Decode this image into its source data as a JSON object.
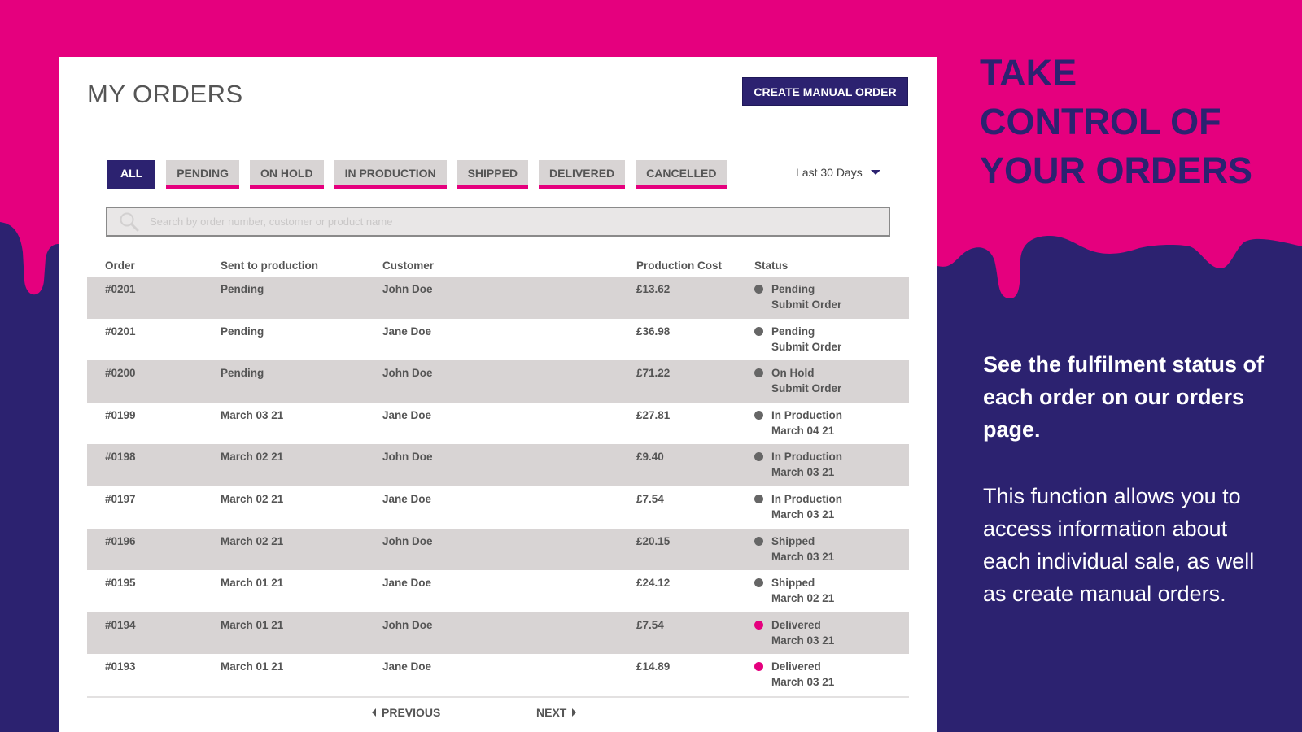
{
  "colors": {
    "brand_pink": "#e5007e",
    "brand_navy": "#2c2270",
    "row_shade": "#d8d4d4",
    "status_grey": "#666666",
    "status_delivered": "#e5007e"
  },
  "header": {
    "title": "MY ORDERS",
    "create_button": "CREATE MANUAL ORDER"
  },
  "filters": {
    "tabs": [
      {
        "label": "ALL",
        "active": true
      },
      {
        "label": "PENDING",
        "active": false
      },
      {
        "label": "ON HOLD",
        "active": false
      },
      {
        "label": "IN PRODUCTION",
        "active": false
      },
      {
        "label": "SHIPPED",
        "active": false
      },
      {
        "label": "DELIVERED",
        "active": false
      },
      {
        "label": "CANCELLED",
        "active": false
      }
    ],
    "date_range": "Last 30 Days"
  },
  "search": {
    "icon": "search-icon",
    "placeholder": "Search by order number, customer or product name",
    "value": ""
  },
  "table": {
    "columns": [
      "Order",
      "Sent to production",
      "Customer",
      "Production Cost",
      "Status"
    ],
    "rows": [
      {
        "order": "#0201",
        "sent": "Pending",
        "customer": "John Doe",
        "cost": "£13.62",
        "status": "Pending",
        "status_sub": "Submit Order",
        "dot": "grey"
      },
      {
        "order": "#0201",
        "sent": "Pending",
        "customer": "Jane Doe",
        "cost": "£36.98",
        "status": "Pending",
        "status_sub": "Submit Order",
        "dot": "grey"
      },
      {
        "order": "#0200",
        "sent": "Pending",
        "customer": "John Doe",
        "cost": "£71.22",
        "status": "On Hold",
        "status_sub": "Submit Order",
        "dot": "grey"
      },
      {
        "order": "#0199",
        "sent": "March 03 21",
        "customer": "Jane Doe",
        "cost": "£27.81",
        "status": "In Production",
        "status_sub": "March 04 21",
        "dot": "grey"
      },
      {
        "order": "#0198",
        "sent": "March 02 21",
        "customer": "John Doe",
        "cost": "£9.40",
        "status": "In Production",
        "status_sub": "March 03 21",
        "dot": "grey"
      },
      {
        "order": "#0197",
        "sent": "March 02 21",
        "customer": "Jane Doe",
        "cost": "£7.54",
        "status": "In Production",
        "status_sub": "March 03 21",
        "dot": "grey"
      },
      {
        "order": "#0196",
        "sent": "March 02 21",
        "customer": "John Doe",
        "cost": "£20.15",
        "status": "Shipped",
        "status_sub": "March 03 21",
        "dot": "grey"
      },
      {
        "order": "#0195",
        "sent": "March 01 21",
        "customer": "Jane Doe",
        "cost": "£24.12",
        "status": "Shipped",
        "status_sub": "March 02 21",
        "dot": "grey"
      },
      {
        "order": "#0194",
        "sent": "March 01 21",
        "customer": "John Doe",
        "cost": "£7.54",
        "status": "Delivered",
        "status_sub": "March 03 21",
        "dot": "pink"
      },
      {
        "order": "#0193",
        "sent": "March 01 21",
        "customer": "Jane Doe",
        "cost": "£14.89",
        "status": "Delivered",
        "status_sub": "March 03 21",
        "dot": "pink"
      }
    ]
  },
  "pagination": {
    "previous": "PREVIOUS",
    "next": "NEXT"
  },
  "promo": {
    "heading_lines": [
      "TAKE",
      "CONTROL OF",
      "YOUR ORDERS"
    ],
    "bold_text": "See the fulfilment status of each order on our orders page.",
    "body_text": "This function allows you to access information about each individual sale, as well as create manual orders."
  }
}
